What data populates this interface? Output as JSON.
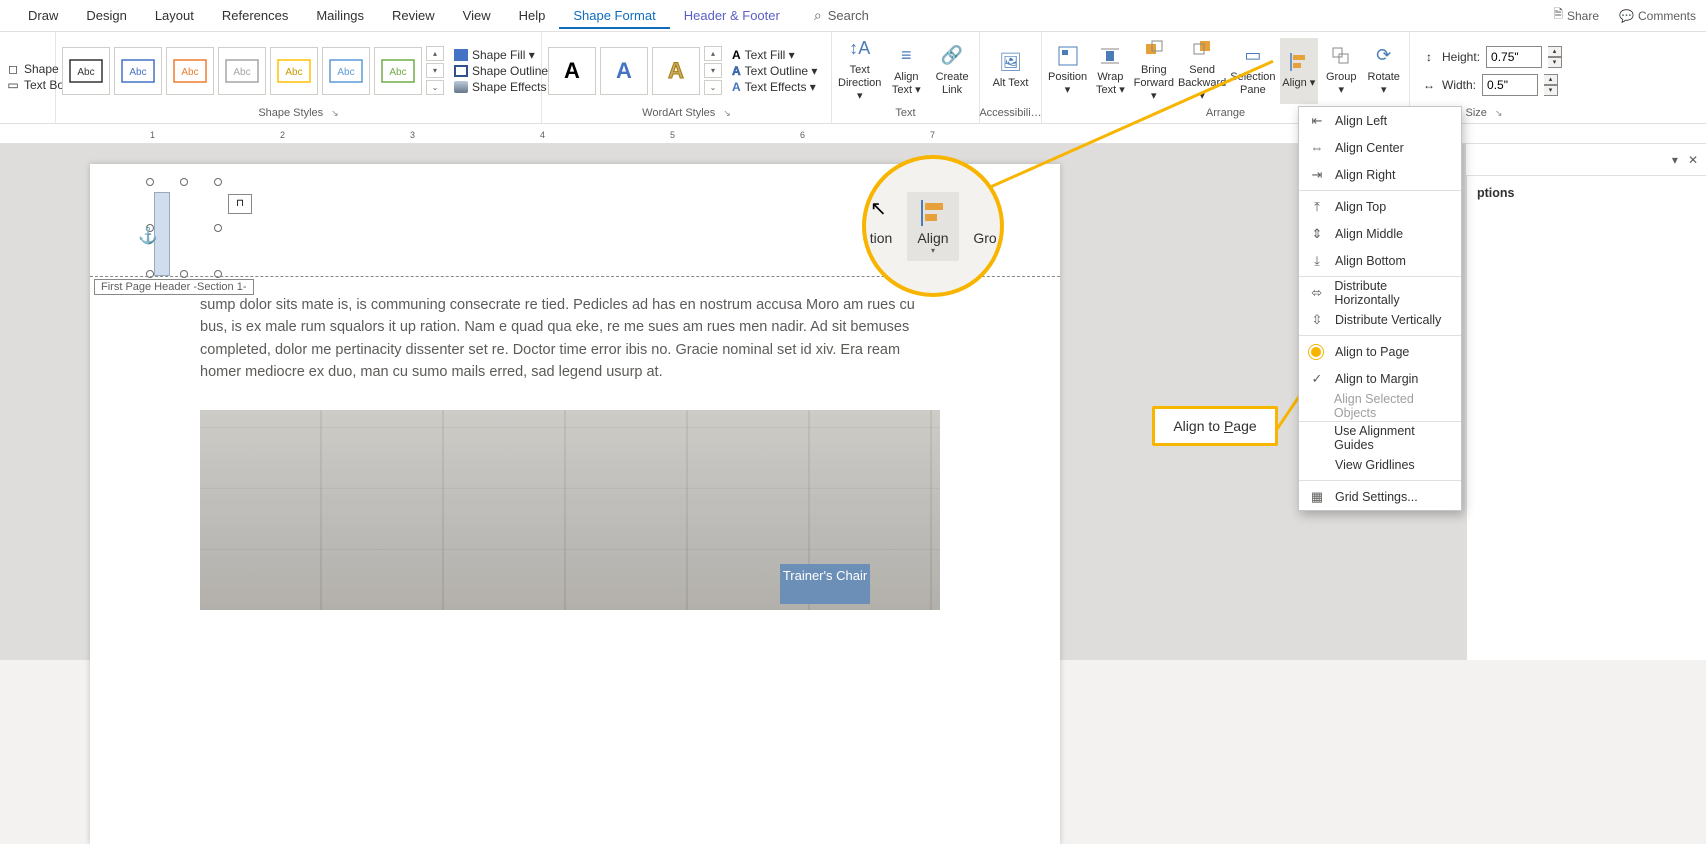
{
  "tabs": {
    "draw": "Draw",
    "design": "Design",
    "layout": "Layout",
    "references": "References",
    "mailings": "Mailings",
    "review": "Review",
    "view": "View",
    "help": "Help",
    "shape_format": "Shape Format",
    "header_footer": "Header & Footer"
  },
  "search_placeholder": "Search",
  "share": "Share",
  "comments": "Comments",
  "insert_shapes": {
    "shape": "Shape ▾",
    "text_box": "Text Box"
  },
  "shape_styles": {
    "item_label": "Abc",
    "fill": "Shape Fill ▾",
    "outline": "Shape Outline ▾",
    "effects": "Shape Effects ▾",
    "group": "Shape Styles"
  },
  "wordart": {
    "fill": "Text Fill ▾",
    "outline": "Text Outline ▾",
    "effects": "Text Effects ▾",
    "group": "WordArt Styles"
  },
  "text": {
    "direction": "Text Direction ▾",
    "align": "Align Text ▾",
    "link": "Create Link",
    "group": "Text"
  },
  "accessibility": {
    "alt": "Alt Text",
    "group": "Accessibili…"
  },
  "arrange": {
    "position": "Position ▾",
    "wrap": "Wrap Text ▾",
    "forward": "Bring Forward ▾",
    "backward": "Send Backward ▾",
    "selection": "Selection Pane",
    "align": "Align ▾",
    "group_btn": "Group ▾",
    "rotate": "Rotate ▾",
    "group": "Arrange"
  },
  "size": {
    "height_label": "Height:",
    "height_val": "0.75\"",
    "width_label": "Width:",
    "width_val": "0.5\"",
    "group": "Size"
  },
  "align_menu": {
    "left": "Align Left",
    "center": "Align Center",
    "right": "Align Right",
    "top": "Align Top",
    "middle": "Align Middle",
    "bottom": "Align Bottom",
    "dist_h": "Distribute Horizontally",
    "dist_v": "Distribute Vertically",
    "to_page": "Align to Page",
    "to_margin": "Align to Margin",
    "sel_obj": "Align Selected Objects",
    "guides": "Use Alignment Guides",
    "gridlines": "View Gridlines",
    "grid_settings": "Grid Settings..."
  },
  "callout": {
    "selection": "tion",
    "align": "Align",
    "group": "Gro"
  },
  "hl_label": "Align to Page",
  "header_tag": "First Page Header -Section 1-",
  "doc_text": "sump dolor sits mate is, is communing consecrate re tied. Pedicles ad has en nostrum accusa        Moro am rues cu bus, is ex male rum squalors it up ration. Nam e quad qua eke, re me sues am rues men nadir. Ad sit bemuses completed, dolor me pertinacity dissenter set re. Doctor time error ibis no. Gracie nominal set id xiv. Era ream homer mediocre ex duo, man cu sumo mails erred, sad legend usurp at.",
  "trainer": "Trainer's Chair",
  "ruler_marks": [
    "1",
    "2",
    "3",
    "4",
    "5",
    "6",
    "7"
  ],
  "taskpane": {
    "options": "ptions"
  }
}
